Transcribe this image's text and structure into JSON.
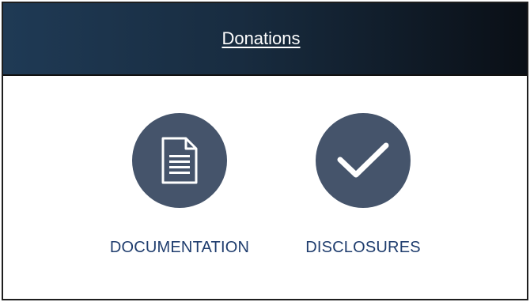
{
  "header": {
    "title": "Donations"
  },
  "tiles": [
    {
      "label": "DOCUMENTATION",
      "icon": "document-icon"
    },
    {
      "label": "DISCLOSURES",
      "icon": "checkmark-icon"
    }
  ],
  "colors": {
    "header_start": "#1f3a55",
    "header_end": "#0a0f16",
    "icon_circle": "#45546b",
    "label_text": "#1f3d6e"
  }
}
